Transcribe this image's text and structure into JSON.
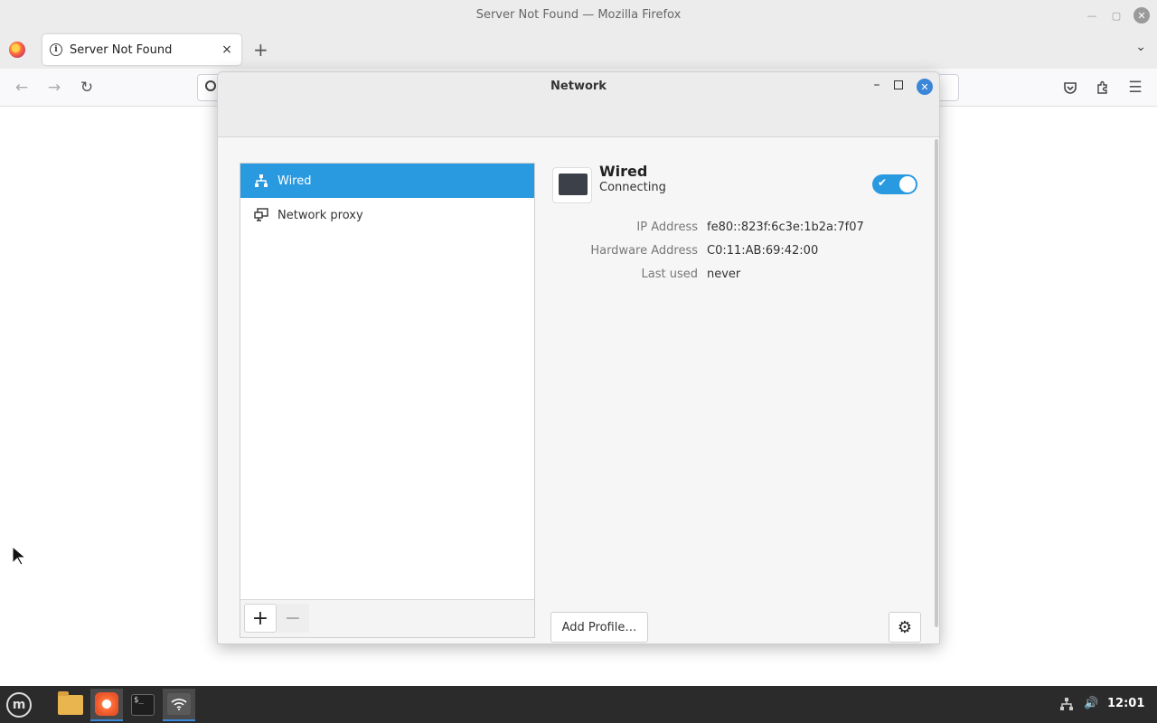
{
  "firefox": {
    "window_title": "Server Not Found — Mozilla Firefox",
    "tab_title": "Server Not Found",
    "tab_close": "×",
    "new_tab": "+"
  },
  "dialog": {
    "title": "Network",
    "sidebar": {
      "items": [
        {
          "label": "Wired",
          "icon": "wired-network-icon",
          "selected": true
        },
        {
          "label": "Network proxy",
          "icon": "network-proxy-icon",
          "selected": false
        }
      ],
      "add_label": "+",
      "remove_label": "−"
    },
    "device": {
      "name": "Wired",
      "status": "Connecting",
      "enabled": true,
      "properties": [
        {
          "label": "IP Address",
          "value": "fe80::823f:6c3e:1b2a:7f07"
        },
        {
          "label": "Hardware Address",
          "value": "C0:11:AB:69:42:00"
        },
        {
          "label": "Last used",
          "value": "never"
        }
      ]
    },
    "add_profile_label": "Add Profile…"
  },
  "taskbar": {
    "clock": "12:01"
  },
  "colors": {
    "accent": "#2a9ae0",
    "close_button": "#3a86d8"
  }
}
